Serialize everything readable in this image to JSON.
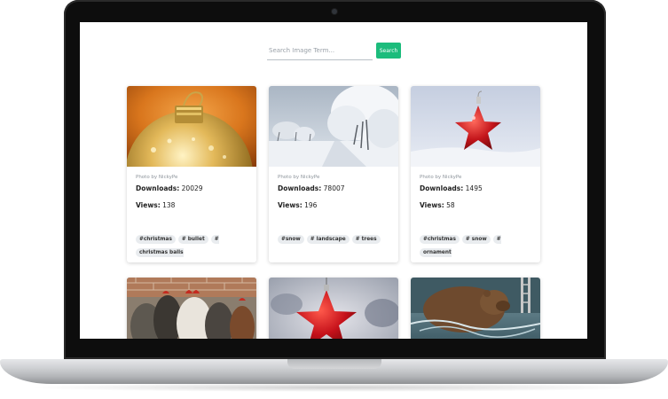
{
  "search": {
    "placeholder": "Search Image Term...",
    "button_label": "Search"
  },
  "cards": [
    {
      "photo_by": "Photo by NickyPe",
      "downloads_label": "Downloads:",
      "downloads": "20029",
      "views_label": "Views:",
      "views": "138",
      "image": "gold-christmas-bauble-photo",
      "tags": [
        "#christmas",
        "# bullet",
        "#"
      ],
      "tags_wrap": "christmas balls"
    },
    {
      "photo_by": "Photo by NickyPe",
      "downloads_label": "Downloads:",
      "downloads": "78007",
      "views_label": "Views:",
      "views": "196",
      "image": "snowy-tree-lined-road-photo",
      "tags": [
        "#snow",
        "# landscape",
        "# trees"
      ]
    },
    {
      "photo_by": "Photo by NickyPe",
      "downloads_label": "Downloads:",
      "downloads": "1495",
      "views_label": "Views:",
      "views": "58",
      "image": "red-star-ornament-in-snow-photo",
      "tags": [
        "#christmas",
        "# snow",
        "#"
      ],
      "tags_wrap": "ornament"
    },
    {
      "image": "chickens-photo"
    },
    {
      "image": "red-star-ornament-photo"
    },
    {
      "image": "bear-in-water-photo"
    }
  ],
  "colors": {
    "search_button": "#1cbc7c",
    "tag_background": "#e9ecef",
    "laptop_bezel": "#0d0d0d"
  }
}
